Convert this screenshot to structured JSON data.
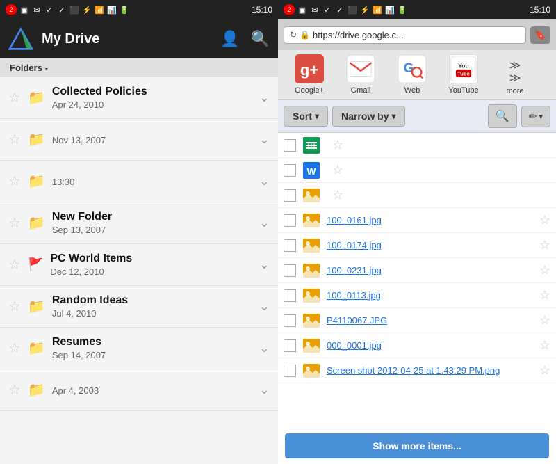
{
  "left": {
    "statusBar": {
      "time": "15:10",
      "badge": "2"
    },
    "header": {
      "title": "My Drive"
    },
    "folders_label": "Folders -",
    "folders": [
      {
        "name": "Collected Policies",
        "date": "Apr 24, 2010",
        "starred": false,
        "flagged": false
      },
      {
        "name": "",
        "date": "Nov 13, 2007",
        "starred": false,
        "flagged": false
      },
      {
        "name": "",
        "date": "13:30",
        "starred": false,
        "flagged": false
      },
      {
        "name": "New Folder",
        "date": "Sep 13, 2007",
        "starred": false,
        "flagged": false
      },
      {
        "name": "PC World Items",
        "date": "Dec 12, 2010",
        "starred": false,
        "flagged": true
      },
      {
        "name": "Random Ideas",
        "date": "Jul 4, 2010",
        "starred": false,
        "flagged": false
      },
      {
        "name": "Resumes",
        "date": "Sep 14, 2007",
        "starred": false,
        "flagged": false
      },
      {
        "name": "",
        "date": "Apr 4, 2008",
        "starred": false,
        "flagged": false
      }
    ]
  },
  "right": {
    "statusBar": {
      "time": "15:10",
      "badge": "2"
    },
    "browser": {
      "url": "https://drive.google.c...",
      "bookmarks": [
        {
          "label": "Google+",
          "icon": "gplus"
        },
        {
          "label": "Gmail",
          "icon": "gmail"
        },
        {
          "label": "Web",
          "icon": "gsearch"
        },
        {
          "label": "YouTube",
          "icon": "youtube"
        },
        {
          "label": "more",
          "icon": "more"
        }
      ]
    },
    "toolbar": {
      "sort_label": "Sort",
      "narrow_label": "Narrow by"
    },
    "files": [
      {
        "type": "gdocs",
        "name": "",
        "link": false
      },
      {
        "type": "word",
        "name": "",
        "link": false
      },
      {
        "type": "img",
        "name": "",
        "link": false
      },
      {
        "type": "img",
        "name": "100_0161.jpg",
        "link": true
      },
      {
        "type": "img",
        "name": "100_0174.jpg",
        "link": true
      },
      {
        "type": "img",
        "name": "100_0231.jpg",
        "link": true
      },
      {
        "type": "img",
        "name": "100_0113.jpg",
        "link": true
      },
      {
        "type": "img",
        "name": "P4110067.JPG",
        "link": true
      },
      {
        "type": "img",
        "name": "000_0001.jpg",
        "link": true
      },
      {
        "type": "img",
        "name": "Screen shot 2012-04-25 at 1.43.29 PM.png",
        "link": true
      }
    ],
    "show_more_label": "Show more items..."
  }
}
